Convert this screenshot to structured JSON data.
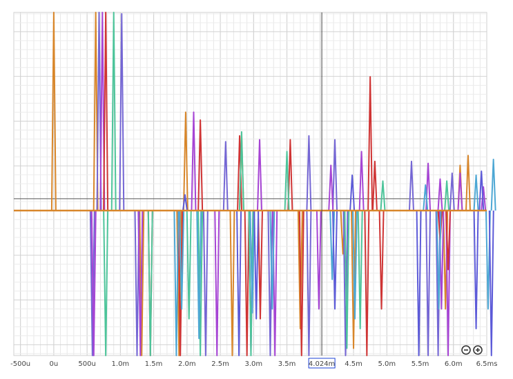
{
  "chart_data": {
    "type": "line",
    "x_unit": "s",
    "xlim": [
      -0.0006,
      0.0065
    ],
    "ylim": [
      -1.15,
      1.15
    ],
    "grid": true,
    "tick_values": [
      -0.0005,
      0,
      0.0005,
      0.001,
      0.0015,
      0.002,
      0.0025,
      0.003,
      0.0035,
      0.004,
      0.0045,
      0.005,
      0.0055,
      0.006,
      0.0065
    ],
    "tick_labels": [
      "-500u",
      "0u",
      "500u",
      "1.0m",
      "1.5m",
      "2.0m",
      "2.5m",
      "3.0m",
      "3.5m",
      "",
      "4.5m",
      "5.0m",
      "5.5m",
      "6.0m",
      "6.5ms"
    ],
    "cursor": {
      "x": 0.004024,
      "label": "4.024m",
      "color": "#1a3fd6"
    },
    "horizontal_marker": 0.06,
    "series": [
      {
        "color": "#d8862a",
        "spikes": [
          [
            0.0,
            1.15
          ],
          [
            0.00063,
            1.15
          ],
          [
            0.00132,
            -1.15
          ],
          [
            0.00188,
            -1.15
          ],
          [
            0.00198,
            0.5
          ],
          [
            0.00268,
            -1.15
          ],
          [
            0.00282,
            0.38
          ],
          [
            0.0037,
            -0.6
          ],
          [
            0.00434,
            -0.22
          ],
          [
            0.0045,
            -0.7
          ],
          [
            0.00588,
            -0.5
          ],
          [
            0.0061,
            0.23
          ],
          [
            0.00622,
            0.28
          ]
        ]
      },
      {
        "color": "#7466d4",
        "spikes": [
          [
            0.00058,
            -1.15
          ],
          [
            0.00068,
            1.15
          ],
          [
            0.00102,
            1.0
          ],
          [
            0.00125,
            -1.15
          ],
          [
            0.00228,
            -1.15
          ],
          [
            0.00258,
            0.35
          ],
          [
            0.00325,
            -0.82
          ],
          [
            0.00383,
            0.38
          ],
          [
            0.00383,
            -0.75
          ],
          [
            0.00422,
            0.36
          ],
          [
            0.00438,
            -0.85
          ],
          [
            0.00537,
            0.25
          ],
          [
            0.00562,
            -1.15
          ],
          [
            0.00577,
            -0.85
          ],
          [
            0.00598,
            0.19
          ]
        ]
      },
      {
        "color": "#a644d4",
        "spikes": [
          [
            0.0006,
            -1.15
          ],
          [
            0.00073,
            1.15
          ],
          [
            0.0013,
            -1.15
          ],
          [
            0.0021,
            0.5
          ],
          [
            0.00245,
            -1.15
          ],
          [
            0.00296,
            -0.72
          ],
          [
            0.00309,
            0.36
          ],
          [
            0.00332,
            -0.78
          ],
          [
            0.00398,
            -0.5
          ],
          [
            0.00416,
            0.23
          ],
          [
            0.00462,
            0.3
          ],
          [
            0.00562,
            0.24
          ],
          [
            0.00582,
            -0.5
          ],
          [
            0.0058,
            0.16
          ],
          [
            0.00592,
            -0.85
          ],
          [
            0.0061,
            0.19
          ],
          [
            0.00645,
            0.12
          ]
        ]
      },
      {
        "color": "#cf3434",
        "spikes": [
          [
            0.00078,
            1.15
          ],
          [
            0.00145,
            -1.15
          ],
          [
            0.0019,
            -1.15
          ],
          [
            0.0022,
            0.46
          ],
          [
            0.00279,
            0.38
          ],
          [
            0.0029,
            -0.9
          ],
          [
            0.0031,
            -0.55
          ],
          [
            0.00355,
            0.36
          ],
          [
            0.00372,
            -0.85
          ],
          [
            0.0047,
            -1.15
          ],
          [
            0.00475,
            0.68
          ],
          [
            0.00482,
            0.25
          ],
          [
            0.00492,
            -0.5
          ],
          [
            0.0058,
            -0.15
          ],
          [
            0.00592,
            -0.3
          ]
        ]
      },
      {
        "color": "#4dc49a",
        "spikes": [
          [
            0.00078,
            -1.15
          ],
          [
            0.0009,
            1.15
          ],
          [
            0.00145,
            -1.15
          ],
          [
            0.00203,
            -0.55
          ],
          [
            0.0022,
            -0.95
          ],
          [
            0.00282,
            0.4
          ],
          [
            0.00296,
            -0.85
          ],
          [
            0.0035,
            0.3
          ],
          [
            0.0044,
            -0.7
          ],
          [
            0.0046,
            -0.6
          ],
          [
            0.00494,
            0.15
          ],
          [
            0.0059,
            0.15
          ]
        ]
      },
      {
        "color": "#4da7d4",
        "spikes": [
          [
            0.00184,
            -1.15
          ],
          [
            0.00192,
            -0.5
          ],
          [
            0.00218,
            -0.65
          ],
          [
            0.00298,
            -0.52
          ],
          [
            0.00328,
            -0.5
          ],
          [
            0.00418,
            -0.35
          ],
          [
            0.00452,
            -0.55
          ],
          [
            0.00578,
            -0.5
          ],
          [
            0.00558,
            0.13
          ],
          [
            0.00634,
            0.18
          ],
          [
            0.00652,
            -0.5
          ],
          [
            0.0066,
            0.26
          ]
        ]
      },
      {
        "color": "#5c5ad8",
        "spikes": [
          [
            0.00197,
            0.08
          ],
          [
            0.00278,
            -1.15
          ],
          [
            0.00304,
            -0.55
          ],
          [
            0.00422,
            -0.5
          ],
          [
            0.00448,
            0.18
          ],
          [
            0.00548,
            -1.15
          ],
          [
            0.00634,
            -0.6
          ],
          [
            0.00642,
            0.2
          ],
          [
            0.00657,
            -0.9
          ]
        ]
      }
    ]
  },
  "zoom": {
    "out_icon": "zoom-out-icon",
    "in_icon": "zoom-in-icon"
  }
}
